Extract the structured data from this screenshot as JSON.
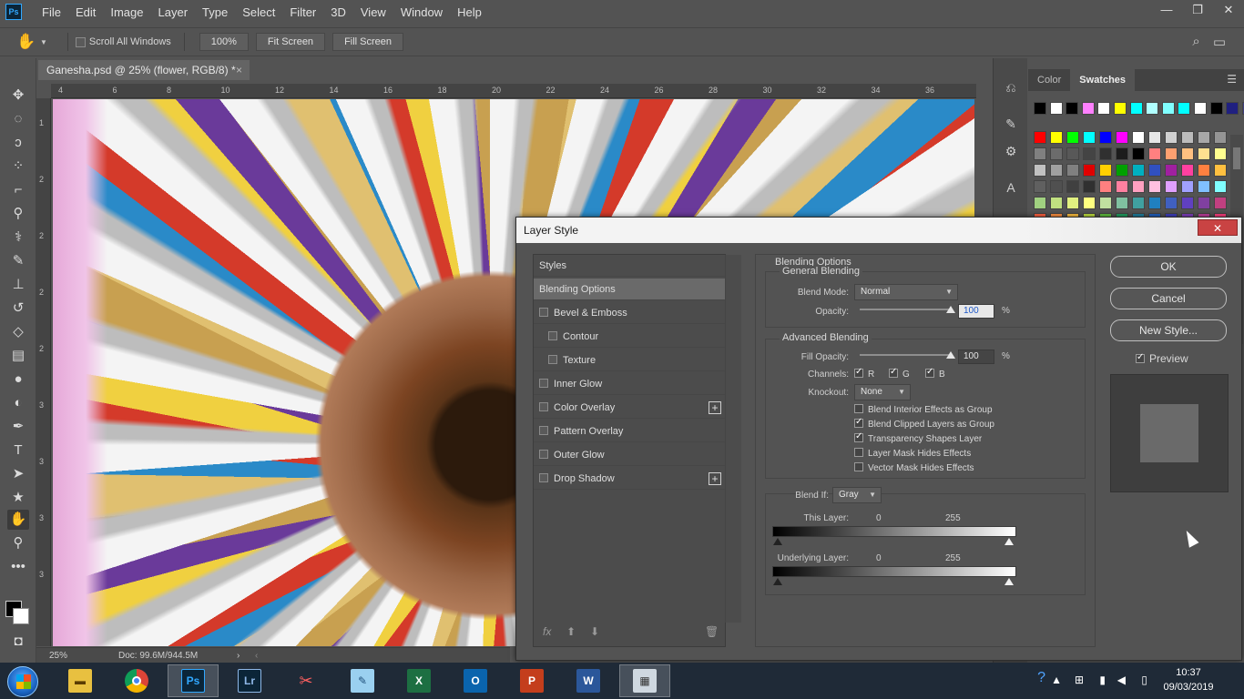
{
  "app": {
    "logo": "Ps",
    "menu": [
      "File",
      "Edit",
      "Image",
      "Layer",
      "Type",
      "Select",
      "Filter",
      "3D",
      "View",
      "Window",
      "Help"
    ],
    "window_controls": [
      "—",
      "❐",
      "✕"
    ]
  },
  "options_bar": {
    "scroll_all_windows": "Scroll All Windows",
    "zoom_100": "100%",
    "fit_screen": "Fit Screen",
    "fill_screen": "Fill Screen"
  },
  "document": {
    "tab_title": "Ganesha.psd @ 25% (flower, RGB/8) *",
    "close": "×",
    "ruler_top": [
      "4",
      "6",
      "8",
      "10",
      "12",
      "14",
      "16",
      "18",
      "20",
      "22",
      "24",
      "26",
      "28",
      "30",
      "32",
      "34",
      "36"
    ],
    "ruler_left": [
      "1",
      "2",
      "2",
      "2",
      "2",
      "3",
      "3",
      "3",
      "3"
    ],
    "status": {
      "zoom": "25%",
      "doc": "Doc: 99.6M/944.5M",
      "arrow": "›",
      "arrow2": "‹"
    }
  },
  "panels": {
    "tabs": [
      "Color",
      "Swatches"
    ],
    "active_tab": "Swatches",
    "swatch_row1": [
      "#000000",
      "#ffffff",
      "#000000",
      "#ff80ff",
      "#ffffff",
      "#ffff00",
      "#00ffff",
      "#b0ffff",
      "#80ffff",
      "#00ffff",
      "#ffffff",
      "#000000",
      "#202080",
      "#404080"
    ],
    "swatch_rows": [
      [
        "#ff0000",
        "#ffff00",
        "#00ff00",
        "#00ffff",
        "#0000ff",
        "#ff00ff",
        "#ffffff",
        "#e6e6e6",
        "#d0d0d0",
        "#bcbcbc",
        "#a8a8a8",
        "#949494"
      ],
      [
        "#808080",
        "#6c6c6c",
        "#585858",
        "#444444",
        "#303030",
        "#1c1c1c",
        "#000000",
        "#ff8080",
        "#ffa070",
        "#ffc080",
        "#ffe090",
        "#ffff90"
      ],
      [
        "#c0c0c0",
        "#a0a0a0",
        "#808080",
        "#e00000",
        "#ffd000",
        "#00a000",
        "#00b0c0",
        "#3050c0",
        "#a020a0",
        "#ff40a0",
        "#ff8040",
        "#ffc040"
      ],
      [
        "#606060",
        "#505050",
        "#404040",
        "#303030",
        "#ff8080",
        "#ff80a0",
        "#ffa0c0",
        "#ffc0e0",
        "#e0a0ff",
        "#a0a0ff",
        "#80c0ff",
        "#80ffff"
      ],
      [
        "#a0d080",
        "#c0e080",
        "#e0f080",
        "#ffff80",
        "#c0e0a0",
        "#80c0a0",
        "#40a0a0",
        "#2080c0",
        "#4060c0",
        "#6040c0",
        "#8040a0",
        "#c04080"
      ],
      [
        "#ff6040",
        "#ff9040",
        "#ffc040",
        "#c0e040",
        "#60c040",
        "#20a060",
        "#2080a0",
        "#2060c0",
        "#4040c0",
        "#8040c0",
        "#c040a0",
        "#ff4080"
      ]
    ]
  },
  "dialog": {
    "title": "Layer Style",
    "close": "✕",
    "styles_header": "Styles",
    "items": [
      {
        "label": "Blending Options",
        "checkbox": false,
        "selected": true,
        "plus": false,
        "indent": false
      },
      {
        "label": "Bevel & Emboss",
        "checkbox": true,
        "selected": false,
        "plus": false,
        "indent": false
      },
      {
        "label": "Contour",
        "checkbox": true,
        "selected": false,
        "plus": false,
        "indent": true
      },
      {
        "label": "Texture",
        "checkbox": true,
        "selected": false,
        "plus": false,
        "indent": true
      },
      {
        "label": "Inner Glow",
        "checkbox": true,
        "selected": false,
        "plus": false,
        "indent": false
      },
      {
        "label": "Color Overlay",
        "checkbox": true,
        "selected": false,
        "plus": true,
        "indent": false
      },
      {
        "label": "Pattern Overlay",
        "checkbox": true,
        "selected": false,
        "plus": false,
        "indent": false
      },
      {
        "label": "Outer Glow",
        "checkbox": true,
        "selected": false,
        "plus": false,
        "indent": false
      },
      {
        "label": "Drop Shadow",
        "checkbox": true,
        "selected": false,
        "plus": true,
        "indent": false
      }
    ],
    "footer": {
      "fx": "fx",
      "up": "⬆",
      "down": "⬇",
      "trash": "🗑"
    },
    "blending": {
      "section_title": "Blending Options",
      "general_title": "General Blending",
      "blend_mode_label": "Blend Mode:",
      "blend_mode_value": "Normal",
      "opacity_label": "Opacity:",
      "opacity_value": "100",
      "opacity_level": 1.0,
      "percent": "%",
      "advanced_title": "Advanced Blending",
      "fill_opacity_label": "Fill Opacity:",
      "fill_opacity_value": "100",
      "fill_opacity_level": 1.0,
      "channels_label": "Channels:",
      "channel_r": "R",
      "channel_g": "G",
      "channel_b": "B",
      "knockout_label": "Knockout:",
      "knockout_value": "None",
      "options": [
        {
          "label": "Blend Interior Effects as Group",
          "checked": false
        },
        {
          "label": "Blend Clipped Layers as Group",
          "checked": true
        },
        {
          "label": "Transparency Shapes Layer",
          "checked": true
        },
        {
          "label": "Layer Mask Hides Effects",
          "checked": false
        },
        {
          "label": "Vector Mask Hides Effects",
          "checked": false
        }
      ],
      "blend_if_label": "Blend If:",
      "blend_if_value": "Gray",
      "this_layer_label": "This Layer:",
      "this_layer_min": "0",
      "this_layer_max": "255",
      "underlying_label": "Underlying Layer:",
      "underlying_min": "0",
      "underlying_max": "255"
    },
    "buttons": {
      "ok": "OK",
      "cancel": "Cancel",
      "new_style": "New Style..."
    },
    "preview_label": "Preview"
  },
  "taskbar": {
    "apps": [
      "Explorer",
      "Chrome",
      "Ps",
      "Lr",
      "Snipping Tool",
      "Notepad",
      "Excel",
      "Outlook",
      "PowerPoint",
      "Word",
      "Calculator"
    ],
    "time": "10:37",
    "date": "09/03/2019"
  }
}
